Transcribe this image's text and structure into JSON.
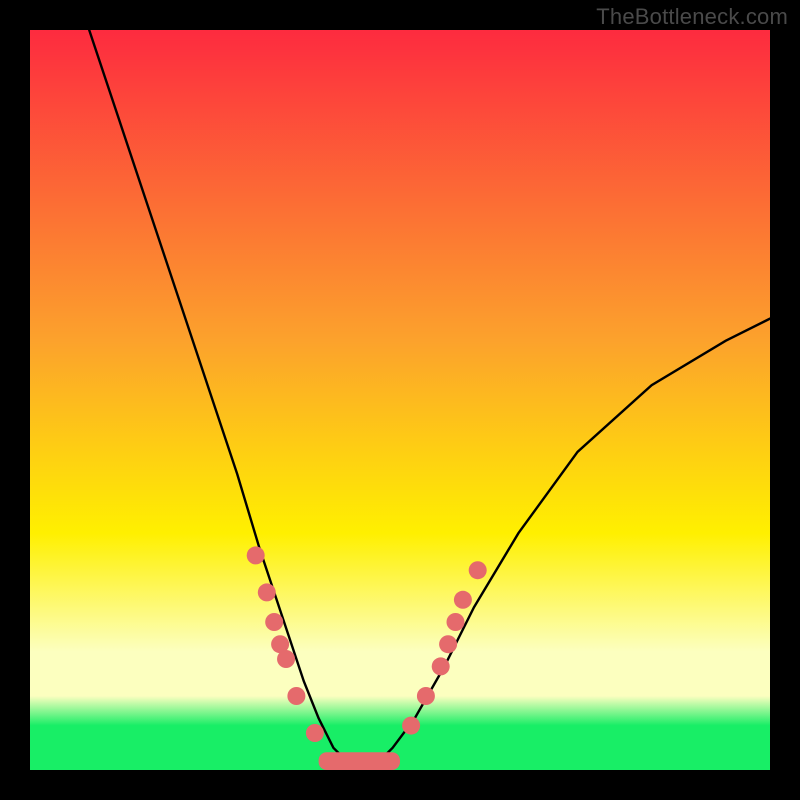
{
  "watermark": "TheBottleneck.com",
  "gradient": {
    "red": "#fd2b3f",
    "orange": "#fca22c",
    "yellow": "#fff000",
    "paleyellow": "#fcffbf",
    "green": "#18ee66"
  },
  "chart_data": {
    "type": "line",
    "title": "",
    "xlabel": "",
    "ylabel": "",
    "xlim": [
      0,
      100
    ],
    "ylim": [
      0,
      100
    ],
    "series": [
      {
        "name": "bottleneck-curve",
        "x": [
          8,
          12,
          16,
          20,
          24,
          28,
          31,
          33,
          35,
          37,
          39,
          41,
          43,
          45,
          47,
          49,
          52,
          56,
          60,
          66,
          74,
          84,
          94,
          100
        ],
        "values": [
          100,
          88,
          76,
          64,
          52,
          40,
          30,
          24,
          18,
          12,
          7,
          3,
          1,
          1,
          1,
          3,
          7,
          14,
          22,
          32,
          43,
          52,
          58,
          61
        ]
      }
    ],
    "markers": {
      "name": "salmon-dots",
      "color": "#e56a6c",
      "points": [
        {
          "x": 30.5,
          "y": 29
        },
        {
          "x": 32.0,
          "y": 24
        },
        {
          "x": 33.0,
          "y": 20
        },
        {
          "x": 33.8,
          "y": 17
        },
        {
          "x": 34.6,
          "y": 15
        },
        {
          "x": 36.0,
          "y": 10
        },
        {
          "x": 38.5,
          "y": 5
        },
        {
          "x": 51.5,
          "y": 6
        },
        {
          "x": 53.5,
          "y": 10
        },
        {
          "x": 55.5,
          "y": 14
        },
        {
          "x": 56.5,
          "y": 17
        },
        {
          "x": 57.5,
          "y": 20
        },
        {
          "x": 58.5,
          "y": 23
        },
        {
          "x": 60.5,
          "y": 27
        }
      ]
    },
    "flat_bottom": {
      "name": "salmon-trough",
      "color": "#e56a6c",
      "x_start": 39,
      "x_end": 50,
      "y": 1.2,
      "thickness": 2.4
    }
  }
}
